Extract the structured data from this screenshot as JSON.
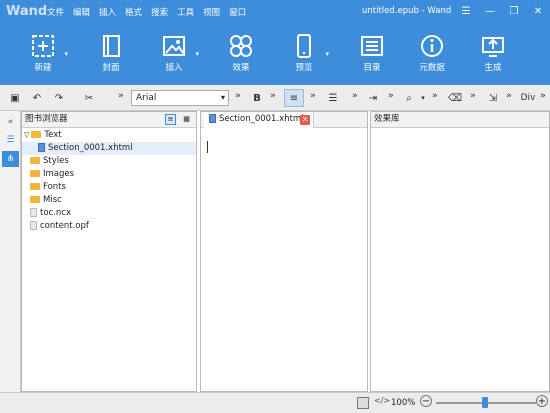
{
  "app": {
    "logo": "Wand",
    "title": "untitled.epub - Wand"
  },
  "menu": [
    "文件",
    "编辑",
    "插入",
    "格式",
    "搜索",
    "工具",
    "视图",
    "窗口"
  ],
  "ribbon": [
    {
      "label": "新建",
      "icon": "new-icon"
    },
    {
      "label": "封面",
      "icon": "cover-icon"
    },
    {
      "label": "插入",
      "icon": "image-icon"
    },
    {
      "label": "效果",
      "icon": "effects-icon"
    },
    {
      "label": "预览",
      "icon": "phone-icon"
    },
    {
      "label": "目录",
      "icon": "toc-icon"
    },
    {
      "label": "元数据",
      "icon": "info-icon"
    },
    {
      "label": "生成",
      "icon": "export-icon"
    }
  ],
  "toolbar": {
    "font": "Arial",
    "bold": "B",
    "div": "Div"
  },
  "browser": {
    "title": "图书浏览器",
    "items": [
      {
        "label": "Text",
        "type": "folder",
        "open": true
      },
      {
        "label": "Section_0001.xhtml",
        "type": "xhtml"
      },
      {
        "label": "Styles",
        "type": "folder"
      },
      {
        "label": "Images",
        "type": "folder"
      },
      {
        "label": "Fonts",
        "type": "folder"
      },
      {
        "label": "Misc",
        "type": "folder"
      },
      {
        "label": "toc.ncx",
        "type": "file"
      },
      {
        "label": "content.opf",
        "type": "file"
      }
    ]
  },
  "editor": {
    "tab": "Section_0001.xhtml"
  },
  "effects": {
    "title": "效果库"
  },
  "status": {
    "zoom": "100%"
  },
  "colors": {
    "ribbon": "#3d8ddb",
    "folder": "#f5b53d",
    "close": "#e85a4a"
  }
}
